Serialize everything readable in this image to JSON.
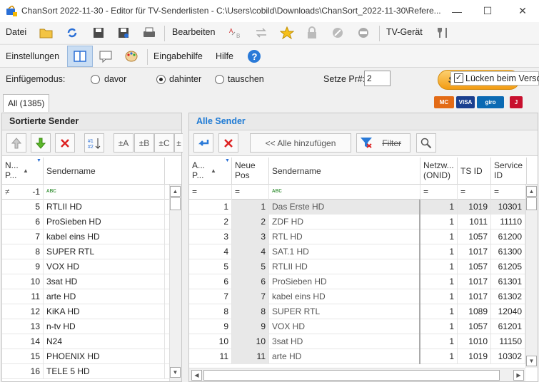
{
  "window": {
    "title": "ChanSort 2022-11-30 - Editor für TV-Senderlisten  -  C:\\Users\\cobild\\Downloads\\ChanSort_2022-11-30\\Refere..."
  },
  "menu": {
    "file": "Datei",
    "edit": "Bearbeiten",
    "tv": "TV-Gerät",
    "settings": "Einstellungen",
    "input": "Eingabehilfe",
    "help": "Hilfe"
  },
  "options": {
    "insert_mode_label": "Einfügemodus:",
    "mode_before": "davor",
    "mode_after": "dahinter",
    "mode_swap": "tauschen",
    "set_pr_label": "Setze Pr#:",
    "set_pr_value": "2",
    "gaps_label": "Lücken beim Versch",
    "donate": "Spenden"
  },
  "tabs": {
    "all": "All (1385)"
  },
  "left": {
    "title": "Sortierte Sender",
    "tool": {
      "pa": "±A",
      "pb": "±B",
      "pc": "±C",
      "pd": "±"
    },
    "headers": {
      "nr": "N...\nP...",
      "name": "Sendername"
    },
    "filter": {
      "nr_op": "≠",
      "nr": "-1",
      "name": "ᴀʙc"
    },
    "rows": [
      {
        "nr": "5",
        "name": "RTLII HD"
      },
      {
        "nr": "6",
        "name": "ProSieben HD"
      },
      {
        "nr": "7",
        "name": "kabel eins HD"
      },
      {
        "nr": "8",
        "name": "SUPER RTL"
      },
      {
        "nr": "9",
        "name": "VOX HD"
      },
      {
        "nr": "10",
        "name": "3sat HD"
      },
      {
        "nr": "11",
        "name": "arte HD"
      },
      {
        "nr": "12",
        "name": "KiKA HD"
      },
      {
        "nr": "13",
        "name": "n-tv HD"
      },
      {
        "nr": "14",
        "name": "N24"
      },
      {
        "nr": "15",
        "name": "PHOENIX HD"
      },
      {
        "nr": "16",
        "name": "TELE 5 HD"
      }
    ]
  },
  "right": {
    "title": "Alle Sender",
    "tool": {
      "add_all": "<< Alle hinzufügen",
      "filter": "Filter"
    },
    "headers": {
      "old": "A...\nP...",
      "new": "Neue\nPos",
      "name": "Sendername",
      "onid": "Netzw...\n(ONID)",
      "tsid": "TS ID",
      "sid": "Service\nID"
    },
    "filter": {
      "eq": "=",
      "name": "ᴀʙc"
    },
    "rows": [
      {
        "old": "1",
        "new": "1",
        "name": "Das Erste HD",
        "onid": "1",
        "tsid": "1019",
        "sid": "10301"
      },
      {
        "old": "2",
        "new": "2",
        "name": "ZDF HD",
        "onid": "1",
        "tsid": "1011",
        "sid": "11110"
      },
      {
        "old": "3",
        "new": "3",
        "name": "RTL HD",
        "onid": "1",
        "tsid": "1057",
        "sid": "61200"
      },
      {
        "old": "4",
        "new": "4",
        "name": "SAT.1 HD",
        "onid": "1",
        "tsid": "1017",
        "sid": "61300"
      },
      {
        "old": "5",
        "new": "5",
        "name": "RTLII HD",
        "onid": "1",
        "tsid": "1057",
        "sid": "61205"
      },
      {
        "old": "6",
        "new": "6",
        "name": "ProSieben HD",
        "onid": "1",
        "tsid": "1017",
        "sid": "61301"
      },
      {
        "old": "7",
        "new": "7",
        "name": "kabel eins HD",
        "onid": "1",
        "tsid": "1017",
        "sid": "61302"
      },
      {
        "old": "8",
        "new": "8",
        "name": "SUPER RTL",
        "onid": "1",
        "tsid": "1089",
        "sid": "12040"
      },
      {
        "old": "9",
        "new": "9",
        "name": "VOX HD",
        "onid": "1",
        "tsid": "1057",
        "sid": "61201"
      },
      {
        "old": "10",
        "new": "10",
        "name": "3sat HD",
        "onid": "1",
        "tsid": "1010",
        "sid": "11150"
      },
      {
        "old": "11",
        "new": "11",
        "name": "arte HD",
        "onid": "1",
        "tsid": "1019",
        "sid": "10302"
      }
    ]
  },
  "colors": {
    "accent": "#1e7ad4",
    "donate": "#f7a11a"
  }
}
